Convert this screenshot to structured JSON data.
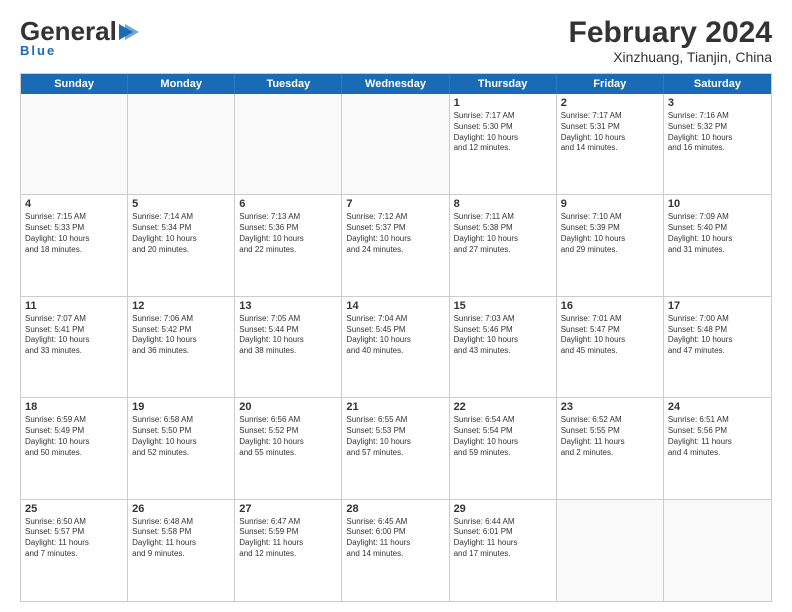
{
  "header": {
    "logo_general": "General",
    "logo_blue": "Blue",
    "main_title": "February 2024",
    "subtitle": "Xinzhuang, Tianjin, China"
  },
  "calendar": {
    "weekdays": [
      "Sunday",
      "Monday",
      "Tuesday",
      "Wednesday",
      "Thursday",
      "Friday",
      "Saturday"
    ],
    "weeks": [
      [
        {
          "day": "",
          "info": "",
          "empty": true
        },
        {
          "day": "",
          "info": "",
          "empty": true
        },
        {
          "day": "",
          "info": "",
          "empty": true
        },
        {
          "day": "",
          "info": "",
          "empty": true
        },
        {
          "day": "1",
          "info": "Sunrise: 7:17 AM\nSunset: 5:30 PM\nDaylight: 10 hours\nand 12 minutes."
        },
        {
          "day": "2",
          "info": "Sunrise: 7:17 AM\nSunset: 5:31 PM\nDaylight: 10 hours\nand 14 minutes."
        },
        {
          "day": "3",
          "info": "Sunrise: 7:16 AM\nSunset: 5:32 PM\nDaylight: 10 hours\nand 16 minutes."
        }
      ],
      [
        {
          "day": "4",
          "info": "Sunrise: 7:15 AM\nSunset: 5:33 PM\nDaylight: 10 hours\nand 18 minutes."
        },
        {
          "day": "5",
          "info": "Sunrise: 7:14 AM\nSunset: 5:34 PM\nDaylight: 10 hours\nand 20 minutes."
        },
        {
          "day": "6",
          "info": "Sunrise: 7:13 AM\nSunset: 5:36 PM\nDaylight: 10 hours\nand 22 minutes."
        },
        {
          "day": "7",
          "info": "Sunrise: 7:12 AM\nSunset: 5:37 PM\nDaylight: 10 hours\nand 24 minutes."
        },
        {
          "day": "8",
          "info": "Sunrise: 7:11 AM\nSunset: 5:38 PM\nDaylight: 10 hours\nand 27 minutes."
        },
        {
          "day": "9",
          "info": "Sunrise: 7:10 AM\nSunset: 5:39 PM\nDaylight: 10 hours\nand 29 minutes."
        },
        {
          "day": "10",
          "info": "Sunrise: 7:09 AM\nSunset: 5:40 PM\nDaylight: 10 hours\nand 31 minutes."
        }
      ],
      [
        {
          "day": "11",
          "info": "Sunrise: 7:07 AM\nSunset: 5:41 PM\nDaylight: 10 hours\nand 33 minutes."
        },
        {
          "day": "12",
          "info": "Sunrise: 7:06 AM\nSunset: 5:42 PM\nDaylight: 10 hours\nand 36 minutes."
        },
        {
          "day": "13",
          "info": "Sunrise: 7:05 AM\nSunset: 5:44 PM\nDaylight: 10 hours\nand 38 minutes."
        },
        {
          "day": "14",
          "info": "Sunrise: 7:04 AM\nSunset: 5:45 PM\nDaylight: 10 hours\nand 40 minutes."
        },
        {
          "day": "15",
          "info": "Sunrise: 7:03 AM\nSunset: 5:46 PM\nDaylight: 10 hours\nand 43 minutes."
        },
        {
          "day": "16",
          "info": "Sunrise: 7:01 AM\nSunset: 5:47 PM\nDaylight: 10 hours\nand 45 minutes."
        },
        {
          "day": "17",
          "info": "Sunrise: 7:00 AM\nSunset: 5:48 PM\nDaylight: 10 hours\nand 47 minutes."
        }
      ],
      [
        {
          "day": "18",
          "info": "Sunrise: 6:59 AM\nSunset: 5:49 PM\nDaylight: 10 hours\nand 50 minutes."
        },
        {
          "day": "19",
          "info": "Sunrise: 6:58 AM\nSunset: 5:50 PM\nDaylight: 10 hours\nand 52 minutes."
        },
        {
          "day": "20",
          "info": "Sunrise: 6:56 AM\nSunset: 5:52 PM\nDaylight: 10 hours\nand 55 minutes."
        },
        {
          "day": "21",
          "info": "Sunrise: 6:55 AM\nSunset: 5:53 PM\nDaylight: 10 hours\nand 57 minutes."
        },
        {
          "day": "22",
          "info": "Sunrise: 6:54 AM\nSunset: 5:54 PM\nDaylight: 10 hours\nand 59 minutes."
        },
        {
          "day": "23",
          "info": "Sunrise: 6:52 AM\nSunset: 5:55 PM\nDaylight: 11 hours\nand 2 minutes."
        },
        {
          "day": "24",
          "info": "Sunrise: 6:51 AM\nSunset: 5:56 PM\nDaylight: 11 hours\nand 4 minutes."
        }
      ],
      [
        {
          "day": "25",
          "info": "Sunrise: 6:50 AM\nSunset: 5:57 PM\nDaylight: 11 hours\nand 7 minutes."
        },
        {
          "day": "26",
          "info": "Sunrise: 6:48 AM\nSunset: 5:58 PM\nDaylight: 11 hours\nand 9 minutes."
        },
        {
          "day": "27",
          "info": "Sunrise: 6:47 AM\nSunset: 5:59 PM\nDaylight: 11 hours\nand 12 minutes."
        },
        {
          "day": "28",
          "info": "Sunrise: 6:45 AM\nSunset: 6:00 PM\nDaylight: 11 hours\nand 14 minutes."
        },
        {
          "day": "29",
          "info": "Sunrise: 6:44 AM\nSunset: 6:01 PM\nDaylight: 11 hours\nand 17 minutes."
        },
        {
          "day": "",
          "info": "",
          "empty": true
        },
        {
          "day": "",
          "info": "",
          "empty": true
        }
      ]
    ]
  }
}
